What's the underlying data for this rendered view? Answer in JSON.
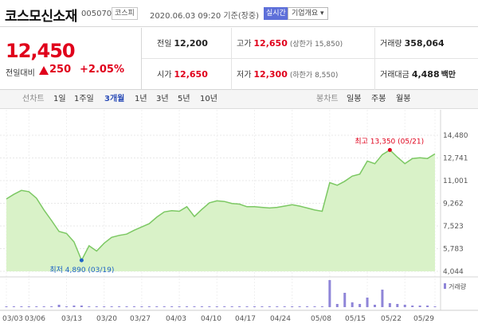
{
  "header": {
    "stock_name": "코스모신소재",
    "stock_code": "005070",
    "market": "코스피",
    "timestamp": "2020.06.03 09:20 기준(장중)",
    "realtime_button": "실시간",
    "company_overview_button": "기업개요 ▾"
  },
  "quote": {
    "price": "12,450",
    "change_label": "전일대비",
    "change_value": "250",
    "change_percent": "+2.05%",
    "up_color": "#e0001b",
    "prev_close_label": "전일",
    "prev_close": "12,200",
    "high_label": "고가",
    "high": "12,650",
    "upper_limit": "(상한가 15,850)",
    "volume_label": "거래량",
    "volume": "358,064",
    "open_label": "시가",
    "open": "12,650",
    "low_label": "저가",
    "low": "12,300",
    "lower_limit": "(하한가 8,550)",
    "turnover_label": "거래대금",
    "turnover": "4,488",
    "turnover_unit": "백만"
  },
  "toolbar": {
    "line_chart_label": "선차트",
    "periods": [
      "1일",
      "1주일",
      "3개월",
      "1년",
      "3년",
      "5년",
      "10년"
    ],
    "active_period": "3개월",
    "candle_chart_label": "봉차트",
    "candle_periods": [
      "일봉",
      "주봉",
      "월봉"
    ]
  },
  "chart_data": {
    "type": "area",
    "y_ticks": [
      "14,480",
      "12,741",
      "11,001",
      "9,262",
      "7,523",
      "5,783",
      "4,044"
    ],
    "ylim": [
      4044,
      14480
    ],
    "x_ticks": [
      "03/03",
      "03/06",
      "03/13",
      "03/20",
      "03/27",
      "04/03",
      "04/10",
      "04/17",
      "04/24",
      "05/08",
      "05/15",
      "05/22",
      "05/29"
    ],
    "price_series": [
      9600,
      9950,
      10250,
      10150,
      9650,
      8750,
      7950,
      7100,
      6950,
      6300,
      4890,
      6000,
      5600,
      6200,
      6650,
      6800,
      6900,
      7200,
      7450,
      7700,
      8200,
      8600,
      8700,
      8650,
      9000,
      8250,
      8800,
      9300,
      9450,
      9400,
      9250,
      9200,
      9000,
      9000,
      8950,
      8900,
      8950,
      9050,
      9150,
      9050,
      8900,
      8750,
      8650,
      10850,
      10650,
      10950,
      11350,
      11500,
      12500,
      12300,
      13000,
      13350,
      12800,
      12300,
      12700,
      12750,
      12700,
      13050
    ],
    "high_annotation": "최고 13,350 (05/21)",
    "low_annotation": "최저 4,890 (03/19)",
    "volume_legend": "거래량",
    "volume_series": [
      1,
      1,
      1,
      1,
      1,
      1,
      1,
      3,
      1,
      2,
      2,
      1,
      1,
      1,
      1,
      1,
      1,
      1,
      1,
      1,
      1,
      1,
      1,
      1,
      1,
      1,
      1,
      1,
      1,
      1,
      1,
      1,
      1,
      1,
      1,
      1,
      1,
      1,
      1,
      1,
      1,
      1,
      1,
      34,
      4,
      18,
      6,
      4,
      12,
      3,
      22,
      5,
      4,
      3,
      2,
      2,
      2,
      1
    ],
    "line_color": "#7cc863",
    "fill_color": "#d9f2c8",
    "volume_color": "#8f85d8"
  }
}
